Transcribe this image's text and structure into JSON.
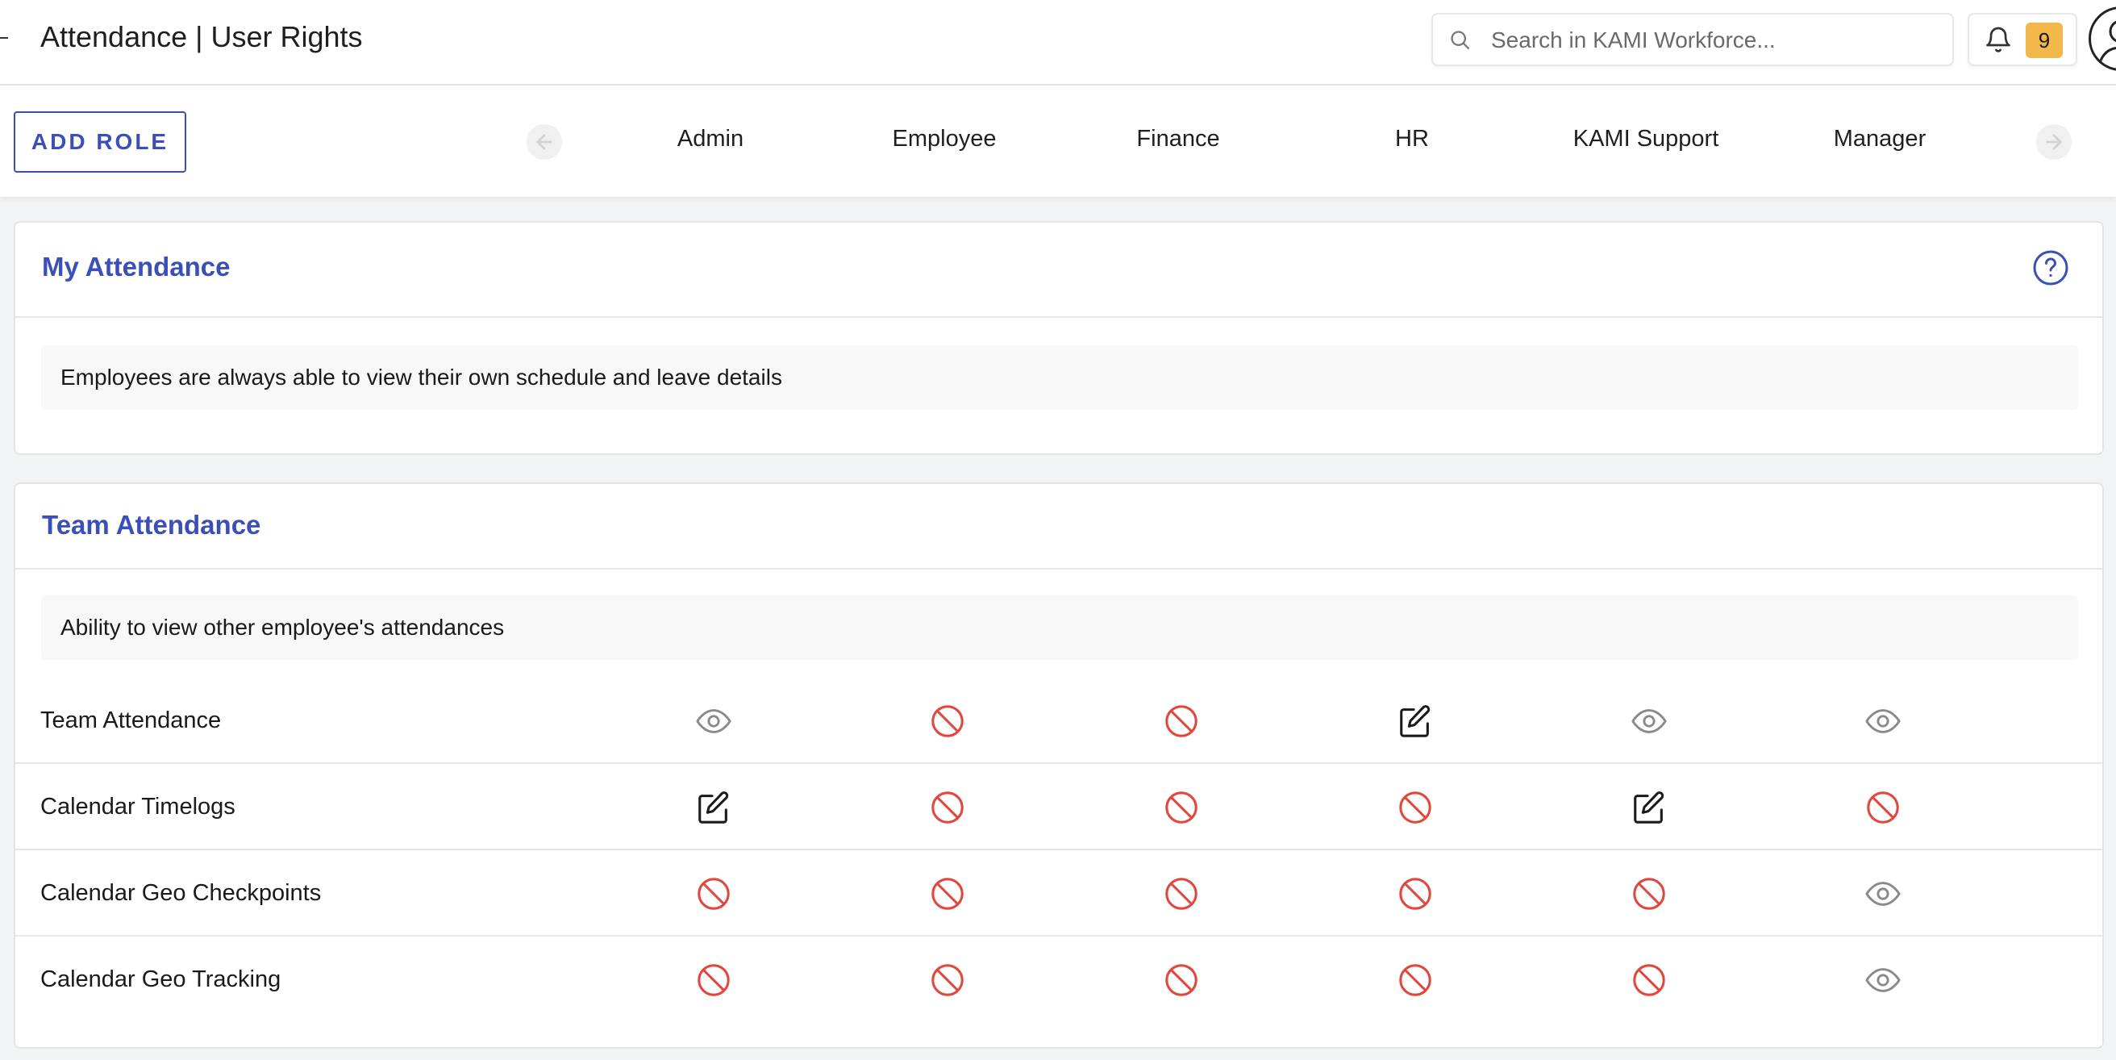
{
  "header": {
    "title": "Attendance | User Rights",
    "search_placeholder": "Search in KAMI Workforce...",
    "notification_count": "9"
  },
  "rolebar": {
    "add_role_label": "ADD ROLE",
    "roles": [
      "Admin",
      "Employee",
      "Finance",
      "HR",
      "KAMI Support",
      "Manager"
    ]
  },
  "my_attendance": {
    "title": "My Attendance",
    "note": "Employees are always able to view their own schedule and leave details"
  },
  "team_attendance": {
    "title": "Team Attendance",
    "note": "Ability to view other employee's attendances",
    "rows": [
      {
        "label": "Team Attendance",
        "permissions": [
          "view",
          "none",
          "none",
          "edit",
          "view",
          "view"
        ]
      },
      {
        "label": "Calendar Timelogs",
        "permissions": [
          "edit",
          "none",
          "none",
          "none",
          "edit",
          "none"
        ]
      },
      {
        "label": "Calendar Geo Checkpoints",
        "permissions": [
          "none",
          "none",
          "none",
          "none",
          "none",
          "view"
        ]
      },
      {
        "label": "Calendar Geo Tracking",
        "permissions": [
          "none",
          "none",
          "none",
          "none",
          "none",
          "view"
        ]
      }
    ]
  },
  "colors": {
    "accent": "#3b4fb8",
    "denied": "#e0483e",
    "badge": "#f2b84b",
    "view_icon": "#8a8a8a"
  },
  "icons": {
    "view": "eye-icon",
    "edit": "edit-icon",
    "none": "no-access-icon"
  }
}
